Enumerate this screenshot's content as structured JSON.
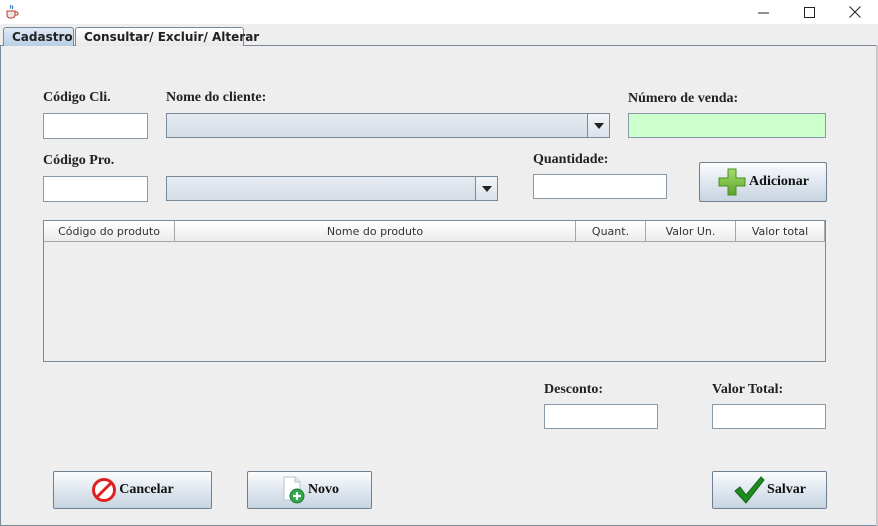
{
  "window": {
    "minimize_glyph": "—",
    "maximize_glyph": "☐",
    "close_glyph": "✕"
  },
  "tabs": [
    {
      "label": "Cadastro",
      "active": true
    },
    {
      "label": "Consultar/ Excluir/ Alterar",
      "active": false
    }
  ],
  "form": {
    "codigo_cli_label": "Código Cli.",
    "codigo_cli_value": "",
    "nome_cliente_label": "Nome do cliente:",
    "nome_cliente_value": "",
    "numero_venda_label": "Número de venda:",
    "numero_venda_value": "",
    "codigo_pro_label": "Código Pro.",
    "codigo_pro_value": "",
    "produto_value": "",
    "quantidade_label": "Quantidade:",
    "quantidade_value": "",
    "adicionar_label": "Adicionar",
    "desconto_label": "Desconto:",
    "desconto_value": "",
    "valor_total_label": "Valor Total:",
    "valor_total_value": ""
  },
  "table": {
    "columns": [
      "Código do produto",
      "Nome do produto",
      "Quant.",
      "Valor Un.",
      "Valor total"
    ],
    "rows": []
  },
  "actions": {
    "cancelar_label": "Cancelar",
    "novo_label": "Novo",
    "salvar_label": "Salvar"
  },
  "colors": {
    "numero_venda_bg": "#ccffcc",
    "panel_bg": "#eeeeee",
    "add_icon": "#7cc242",
    "cancel_icon": "#e02020",
    "save_icon": "#1f8a1f"
  },
  "icons": {
    "app": "java-cup-icon",
    "adicionar": "plus-icon",
    "cancelar": "prohibited-icon",
    "novo": "new-document-icon",
    "salvar": "checkmark-icon"
  }
}
